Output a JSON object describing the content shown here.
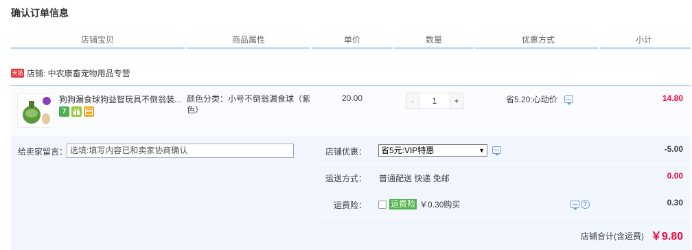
{
  "title": "确认订单信息",
  "columns": [
    "店铺宝贝",
    "商品属性",
    "单价",
    "数量",
    "优惠方式",
    "小计"
  ],
  "shop": {
    "badge": "天猫",
    "label": "店铺: 中农康畜宠物用品专营"
  },
  "item": {
    "title": "狗狗漏食球狗益智玩具不倒翁装...",
    "attr": "颜色分类：小号不倒翁漏食球（紫色）",
    "price": "20.00",
    "quantity": "1",
    "qty_minus": "-",
    "qty_plus": "+",
    "discount": "省5.20:心动价",
    "subtotal": "14.80",
    "service_icons": [
      "7",
      "gift",
      "card"
    ]
  },
  "message": {
    "label": "给卖家留言：",
    "placeholder": "选填:填写内容已和卖家协商确认"
  },
  "shop_discount": {
    "label": "店铺优惠：",
    "selected": "省5元:VIP特惠",
    "value": "-5.00"
  },
  "shipping": {
    "label": "运送方式：",
    "value": "普通配送 快递 免邮",
    "cost": "0.00"
  },
  "insurance": {
    "label": "运费险：",
    "tag": "运费险",
    "text": "￥0.30购买",
    "value": "0.30"
  },
  "total": {
    "label": "店铺合计(含运费)",
    "value": "￥9.80"
  },
  "colors": {
    "accent_red": "#ff0036",
    "line_blue": "#b2d1ff",
    "panel_blue": "#f2f7ff",
    "insurance_green": "#52b24a"
  }
}
